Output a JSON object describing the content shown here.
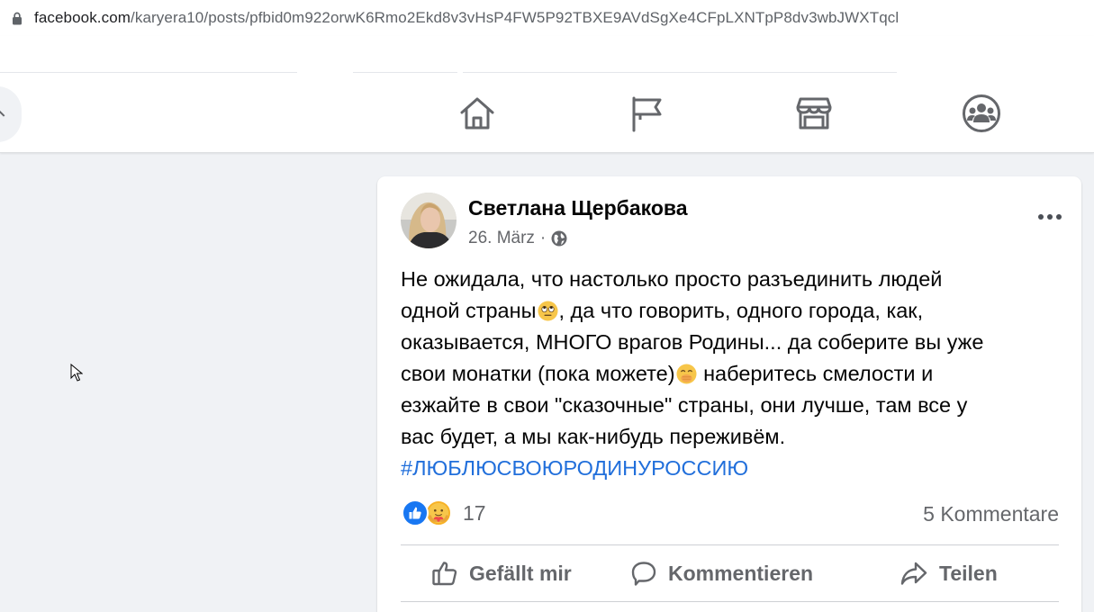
{
  "browser": {
    "url_host": "facebook.com",
    "url_path": "/karyera10/posts/pfbid0m922orwK6Rmo2Ekd8v3vHsP4FW5P92TBXE9AVdSgXe4CFpLXNTpP8dv3wbJWXTqcl"
  },
  "nav": {
    "icons": [
      "home-icon",
      "pages-flag-icon",
      "marketplace-icon",
      "groups-icon"
    ]
  },
  "post": {
    "author": "Светлана Щербакова",
    "date": "26. März",
    "separator": "·",
    "text_lines": {
      "l1": "Не ожидала, что настолько просто разъединить людей",
      "l2a": "одной страны",
      "l2b": ", да что говорить, одного города, как,",
      "l3": "оказывается, МНОГО врагов Родины... да соберите вы уже",
      "l4a": "свои монатки (пока можете)",
      "l4b": " наберитесь смелости и",
      "l5": "езжайте в свои \"сказочные\" страны, они лучше, там все у",
      "l6": "вас будет, а мы как-нибудь переживём."
    },
    "hashtag": "#ЛЮБЛЮСВОЮРОДИНУРОССИЮ",
    "reactions_count": "17",
    "comments_count": "5 Kommentare",
    "actions": {
      "like": "Gefällt mir",
      "comment": "Kommentieren",
      "share": "Teilen"
    }
  },
  "colors": {
    "page_bg": "#f0f2f5",
    "link": "#216fdb",
    "like_blue": "#1877f2",
    "secondary_text": "#65676b"
  }
}
